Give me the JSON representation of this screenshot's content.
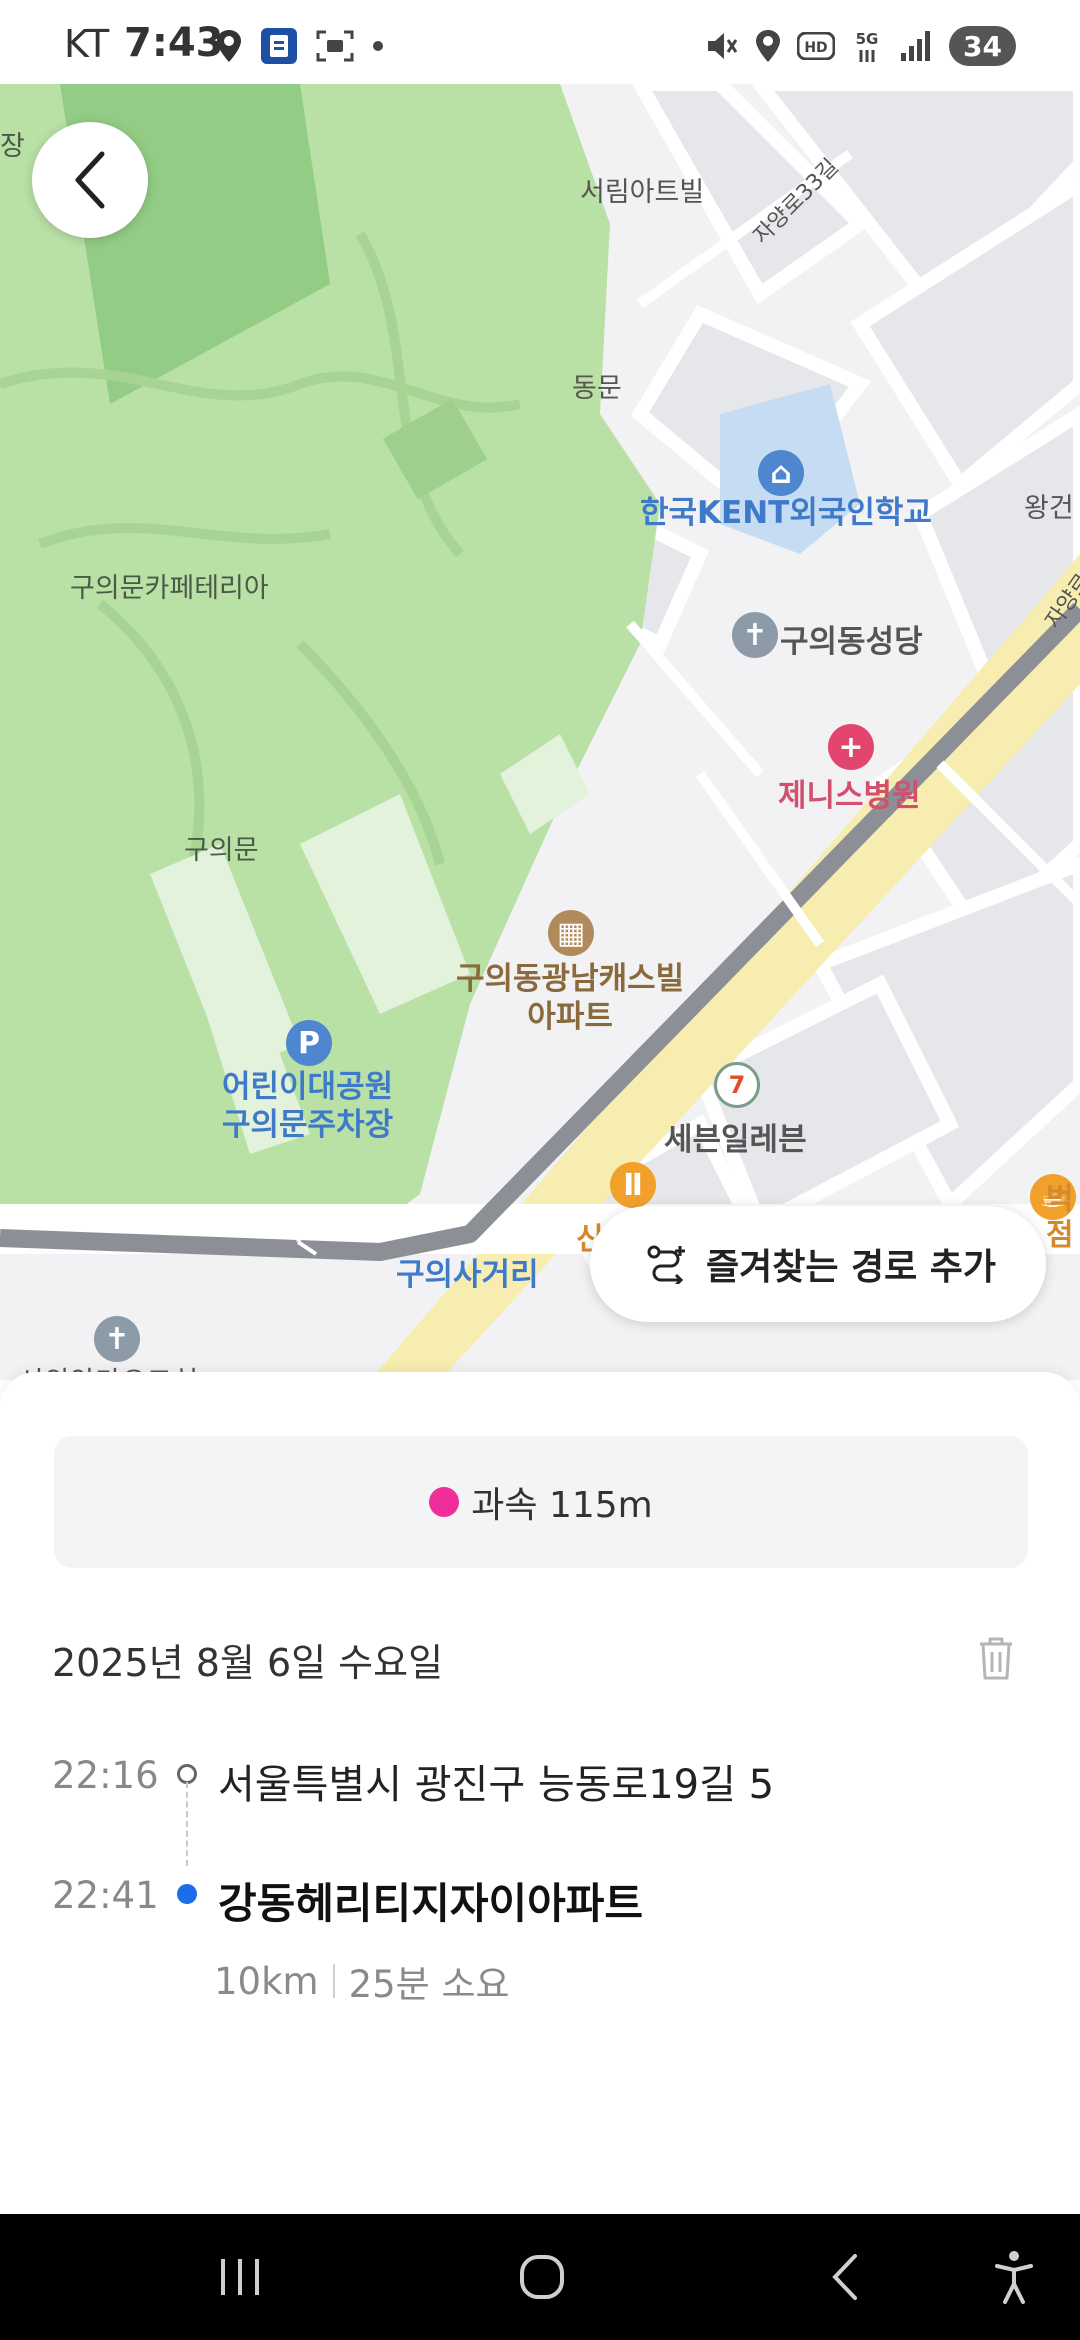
{
  "status_bar": {
    "carrier": "KT",
    "time": "7:43",
    "battery": "34",
    "left_icons": [
      "location-icon",
      "app-notification-icon",
      "screenshot-icon",
      "dot-icon"
    ],
    "right_icons": [
      "mute-icon",
      "location-icon",
      "hd-icon",
      "5g-icon",
      "signal-icon"
    ]
  },
  "map": {
    "labels": {
      "jang": "장",
      "seorim": "서림아트빌",
      "jayangro33": "자양로33길",
      "dongmun": "동문",
      "kent": "한국KENT외국인학교",
      "wanggeon": "왕건",
      "cafeteria": "구의문카페테리아",
      "cathedral": "구의동성당",
      "jangyang": "자양로",
      "jenis": "제니스병원",
      "guuimun": "구의문",
      "apartment": "구의동광남캐스빌\n아파트",
      "parking": "어린이대공원\n구의문주차장",
      "seven": "세븐일레븐",
      "sa": "신",
      "starbucks": "벅\n점",
      "intersection": "구의사거리",
      "church": "시의안마오그처"
    },
    "colors": {
      "park": "#b9e0a5",
      "road": "#f7edb0",
      "route": "#8c9096",
      "background": "#f2f2f4"
    }
  },
  "back_button": {
    "icon": "chevron-left-icon"
  },
  "favorite_button": {
    "label": "즐겨찾는 경로 추가",
    "icon": "route-plus-icon"
  },
  "sheet": {
    "speeding": {
      "label": "과속 115m",
      "color": "#ee2f9a"
    },
    "date": "2025년 8월 6일 수요일",
    "trip": {
      "origin_time": "22:16",
      "origin": "서울특별시 광진구 능동로19길 5",
      "dest_time": "22:41",
      "destination": "강동헤리티지자이아파트",
      "distance": "10km",
      "duration": "25분 소요"
    }
  },
  "nav_bar": {
    "buttons": [
      "recent-apps-icon",
      "home-icon",
      "back-icon",
      "accessibility-icon"
    ]
  }
}
